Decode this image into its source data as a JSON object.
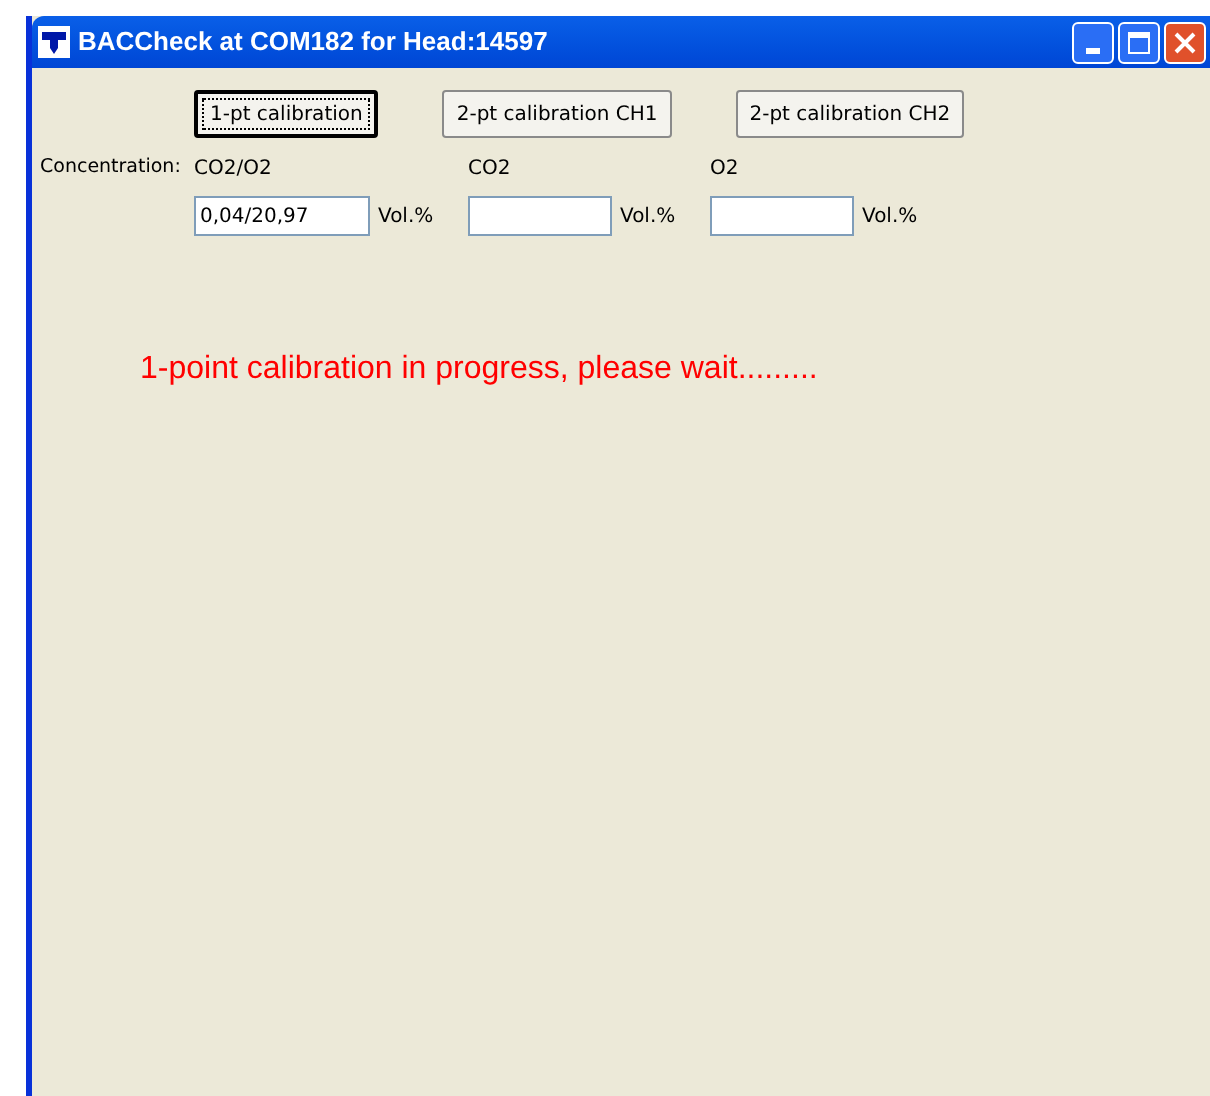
{
  "window": {
    "title": "BACCheck at COM182 for Head:14597"
  },
  "buttons": [
    {
      "label": "1-pt calibration",
      "focused": true
    },
    {
      "label": "2-pt calibration CH1",
      "focused": false
    },
    {
      "label": "2-pt calibration CH2",
      "focused": false
    }
  ],
  "concentration_label": "Concentration:",
  "fields": [
    {
      "label": "CO2/O2",
      "value": "0,04/20,97",
      "unit": "Vol.%"
    },
    {
      "label": "CO2",
      "unit": "Vol.%"
    },
    {
      "label": "O2",
      "unit": "Vol.%"
    }
  ],
  "status_message": "1-point calibration in progress, please wait........."
}
